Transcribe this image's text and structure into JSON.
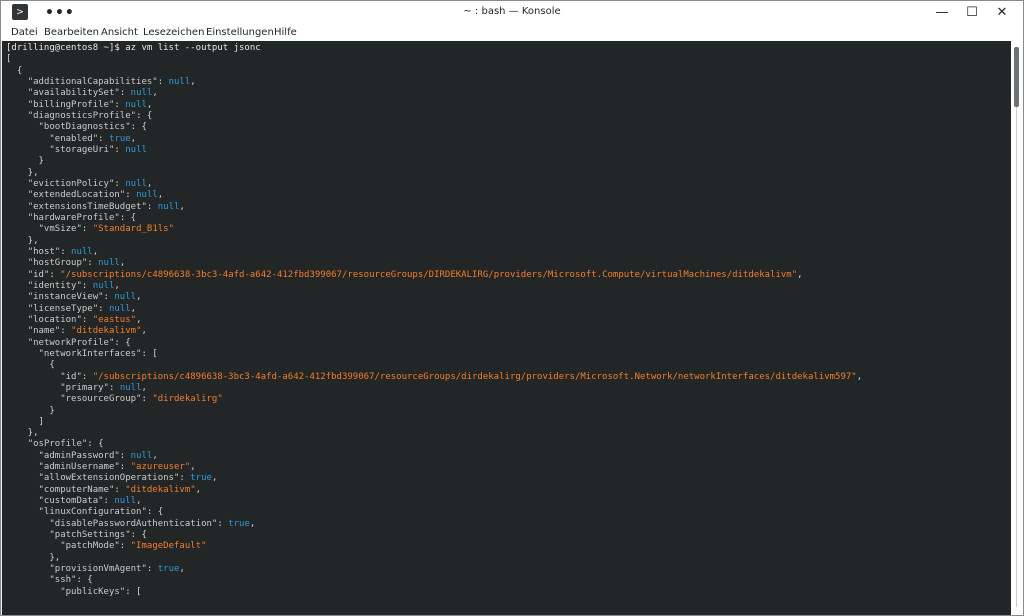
{
  "window": {
    "title": "~ : bash — Konsole",
    "app_icon": "terminal-icon",
    "menu_dots": "•••",
    "controls": {
      "minimize": "—",
      "maximize": "☐",
      "close": "✕"
    }
  },
  "menu": [
    "Datei",
    "Bearbeiten",
    "Ansicht",
    "Lesezeichen",
    "Einstellungen",
    "Hilfe"
  ],
  "colors": {
    "terminal_bg": "#232627",
    "key": "#cacbcd",
    "null_bool": "#2f99d9",
    "string": "#f47d2a"
  },
  "terminal": {
    "lines": [
      [
        [
          "prompt",
          "[drilling@centos8 ~]$ az vm list --output jsonc"
        ]
      ],
      [
        [
          "punct",
          "["
        ]
      ],
      [
        [
          "punct",
          "  {"
        ]
      ],
      [
        [
          "punct",
          "    "
        ],
        [
          "key",
          "\"additionalCapabilities\""
        ],
        [
          "punct",
          ": "
        ],
        [
          "null",
          "null"
        ],
        [
          "punct",
          ","
        ]
      ],
      [
        [
          "punct",
          "    "
        ],
        [
          "key",
          "\"availabilitySet\""
        ],
        [
          "punct",
          ": "
        ],
        [
          "null",
          "null"
        ],
        [
          "punct",
          ","
        ]
      ],
      [
        [
          "punct",
          "    "
        ],
        [
          "key",
          "\"billingProfile\""
        ],
        [
          "punct",
          ": "
        ],
        [
          "null",
          "null"
        ],
        [
          "punct",
          ","
        ]
      ],
      [
        [
          "punct",
          "    "
        ],
        [
          "key",
          "\"diagnosticsProfile\""
        ],
        [
          "punct",
          ": {"
        ]
      ],
      [
        [
          "punct",
          "      "
        ],
        [
          "key",
          "\"bootDiagnostics\""
        ],
        [
          "punct",
          ": {"
        ]
      ],
      [
        [
          "punct",
          "        "
        ],
        [
          "key",
          "\"enabled\""
        ],
        [
          "punct",
          ": "
        ],
        [
          "bool",
          "true"
        ],
        [
          "punct",
          ","
        ]
      ],
      [
        [
          "punct",
          "        "
        ],
        [
          "key",
          "\"storageUri\""
        ],
        [
          "punct",
          ": "
        ],
        [
          "null",
          "null"
        ]
      ],
      [
        [
          "punct",
          "      }"
        ]
      ],
      [
        [
          "punct",
          "    },"
        ]
      ],
      [
        [
          "punct",
          "    "
        ],
        [
          "key",
          "\"evictionPolicy\""
        ],
        [
          "punct",
          ": "
        ],
        [
          "null",
          "null"
        ],
        [
          "punct",
          ","
        ]
      ],
      [
        [
          "punct",
          "    "
        ],
        [
          "key",
          "\"extendedLocation\""
        ],
        [
          "punct",
          ": "
        ],
        [
          "null",
          "null"
        ],
        [
          "punct",
          ","
        ]
      ],
      [
        [
          "punct",
          "    "
        ],
        [
          "key",
          "\"extensionsTimeBudget\""
        ],
        [
          "punct",
          ": "
        ],
        [
          "null",
          "null"
        ],
        [
          "punct",
          ","
        ]
      ],
      [
        [
          "punct",
          "    "
        ],
        [
          "key",
          "\"hardwareProfile\""
        ],
        [
          "punct",
          ": {"
        ]
      ],
      [
        [
          "punct",
          "      "
        ],
        [
          "key",
          "\"vmSize\""
        ],
        [
          "punct",
          ": "
        ],
        [
          "str",
          "\"Standard_B1ls\""
        ]
      ],
      [
        [
          "punct",
          "    },"
        ]
      ],
      [
        [
          "punct",
          "    "
        ],
        [
          "key",
          "\"host\""
        ],
        [
          "punct",
          ": "
        ],
        [
          "null",
          "null"
        ],
        [
          "punct",
          ","
        ]
      ],
      [
        [
          "punct",
          "    "
        ],
        [
          "key",
          "\"hostGroup\""
        ],
        [
          "punct",
          ": "
        ],
        [
          "null",
          "null"
        ],
        [
          "punct",
          ","
        ]
      ],
      [
        [
          "punct",
          "    "
        ],
        [
          "key",
          "\"id\""
        ],
        [
          "punct",
          ": "
        ],
        [
          "str",
          "\"/subscriptions/c4896638-3bc3-4afd-a642-412fbd399067/resourceGroups/DIRDEKALIRG/providers/Microsoft.Compute/virtualMachines/ditdekalivm\""
        ],
        [
          "punct",
          ","
        ]
      ],
      [
        [
          "punct",
          "    "
        ],
        [
          "key",
          "\"identity\""
        ],
        [
          "punct",
          ": "
        ],
        [
          "null",
          "null"
        ],
        [
          "punct",
          ","
        ]
      ],
      [
        [
          "punct",
          "    "
        ],
        [
          "key",
          "\"instanceView\""
        ],
        [
          "punct",
          ": "
        ],
        [
          "null",
          "null"
        ],
        [
          "punct",
          ","
        ]
      ],
      [
        [
          "punct",
          "    "
        ],
        [
          "key",
          "\"licenseType\""
        ],
        [
          "punct",
          ": "
        ],
        [
          "null",
          "null"
        ],
        [
          "punct",
          ","
        ]
      ],
      [
        [
          "punct",
          "    "
        ],
        [
          "key",
          "\"location\""
        ],
        [
          "punct",
          ": "
        ],
        [
          "str",
          "\"eastus\""
        ],
        [
          "punct",
          ","
        ]
      ],
      [
        [
          "punct",
          "    "
        ],
        [
          "key",
          "\"name\""
        ],
        [
          "punct",
          ": "
        ],
        [
          "str",
          "\"ditdekalivm\""
        ],
        [
          "punct",
          ","
        ]
      ],
      [
        [
          "punct",
          "    "
        ],
        [
          "key",
          "\"networkProfile\""
        ],
        [
          "punct",
          ": {"
        ]
      ],
      [
        [
          "punct",
          "      "
        ],
        [
          "key",
          "\"networkInterfaces\""
        ],
        [
          "punct",
          ": ["
        ]
      ],
      [
        [
          "punct",
          "        {"
        ]
      ],
      [
        [
          "punct",
          "          "
        ],
        [
          "key",
          "\"id\""
        ],
        [
          "punct",
          ": "
        ],
        [
          "str",
          "\"/subscriptions/c4896638-3bc3-4afd-a642-412fbd399067/resourceGroups/dirdekalirg/providers/Microsoft.Network/networkInterfaces/ditdekalivm597\""
        ],
        [
          "punct",
          ","
        ]
      ],
      [
        [
          "punct",
          "          "
        ],
        [
          "key",
          "\"primary\""
        ],
        [
          "punct",
          ": "
        ],
        [
          "null",
          "null"
        ],
        [
          "punct",
          ","
        ]
      ],
      [
        [
          "punct",
          "          "
        ],
        [
          "key",
          "\"resourceGroup\""
        ],
        [
          "punct",
          ": "
        ],
        [
          "str",
          "\"dirdekalirg\""
        ]
      ],
      [
        [
          "punct",
          "        }"
        ]
      ],
      [
        [
          "punct",
          "      ]"
        ]
      ],
      [
        [
          "punct",
          "    },"
        ]
      ],
      [
        [
          "punct",
          "    "
        ],
        [
          "key",
          "\"osProfile\""
        ],
        [
          "punct",
          ": {"
        ]
      ],
      [
        [
          "punct",
          "      "
        ],
        [
          "key",
          "\"adminPassword\""
        ],
        [
          "punct",
          ": "
        ],
        [
          "null",
          "null"
        ],
        [
          "punct",
          ","
        ]
      ],
      [
        [
          "punct",
          "      "
        ],
        [
          "key",
          "\"adminUsername\""
        ],
        [
          "punct",
          ": "
        ],
        [
          "str",
          "\"azureuser\""
        ],
        [
          "punct",
          ","
        ]
      ],
      [
        [
          "punct",
          "      "
        ],
        [
          "key",
          "\"allowExtensionOperations\""
        ],
        [
          "punct",
          ": "
        ],
        [
          "bool",
          "true"
        ],
        [
          "punct",
          ","
        ]
      ],
      [
        [
          "punct",
          "      "
        ],
        [
          "key",
          "\"computerName\""
        ],
        [
          "punct",
          ": "
        ],
        [
          "str",
          "\"ditdekalivm\""
        ],
        [
          "punct",
          ","
        ]
      ],
      [
        [
          "punct",
          "      "
        ],
        [
          "key",
          "\"customData\""
        ],
        [
          "punct",
          ": "
        ],
        [
          "null",
          "null"
        ],
        [
          "punct",
          ","
        ]
      ],
      [
        [
          "punct",
          "      "
        ],
        [
          "key",
          "\"linuxConfiguration\""
        ],
        [
          "punct",
          ": {"
        ]
      ],
      [
        [
          "punct",
          "        "
        ],
        [
          "key",
          "\"disablePasswordAuthentication\""
        ],
        [
          "punct",
          ": "
        ],
        [
          "bool",
          "true"
        ],
        [
          "punct",
          ","
        ]
      ],
      [
        [
          "punct",
          "        "
        ],
        [
          "key",
          "\"patchSettings\""
        ],
        [
          "punct",
          ": {"
        ]
      ],
      [
        [
          "punct",
          "          "
        ],
        [
          "key",
          "\"patchMode\""
        ],
        [
          "punct",
          ": "
        ],
        [
          "str",
          "\"ImageDefault\""
        ]
      ],
      [
        [
          "punct",
          "        },"
        ]
      ],
      [
        [
          "punct",
          "        "
        ],
        [
          "key",
          "\"provisionVmAgent\""
        ],
        [
          "punct",
          ": "
        ],
        [
          "bool",
          "true"
        ],
        [
          "punct",
          ","
        ]
      ],
      [
        [
          "punct",
          "        "
        ],
        [
          "key",
          "\"ssh\""
        ],
        [
          "punct",
          ": {"
        ]
      ],
      [
        [
          "punct",
          "          "
        ],
        [
          "key",
          "\"publicKeys\""
        ],
        [
          "punct",
          ": ["
        ]
      ]
    ]
  }
}
